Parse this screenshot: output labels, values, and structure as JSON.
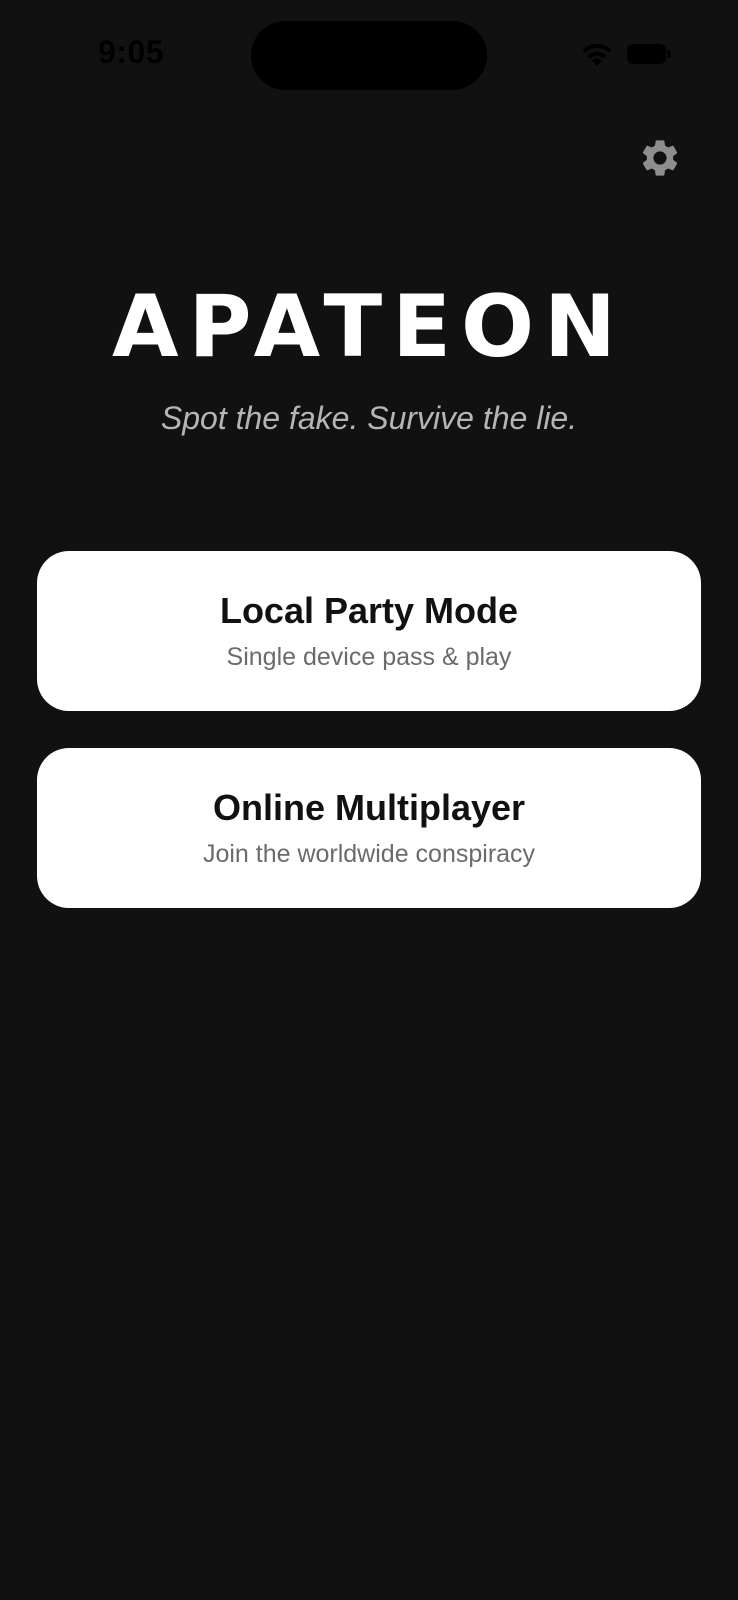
{
  "status_bar": {
    "time": "9:05",
    "wifi_icon": "wifi-icon",
    "battery_icon": "battery-icon"
  },
  "header": {
    "settings_icon": "gear-icon"
  },
  "hero": {
    "title": "APATEON",
    "tagline": "Spot the fake. Survive the lie."
  },
  "modes": [
    {
      "title": "Local Party Mode",
      "subtitle": "Single device pass & play"
    },
    {
      "title": "Online Multiplayer",
      "subtitle": "Join the worldwide conspiracy"
    }
  ],
  "colors": {
    "background": "#111111",
    "card": "#ffffff",
    "title": "#ffffff",
    "tagline": "#b5b5b5",
    "settings_icon": "#8e8e8e"
  }
}
